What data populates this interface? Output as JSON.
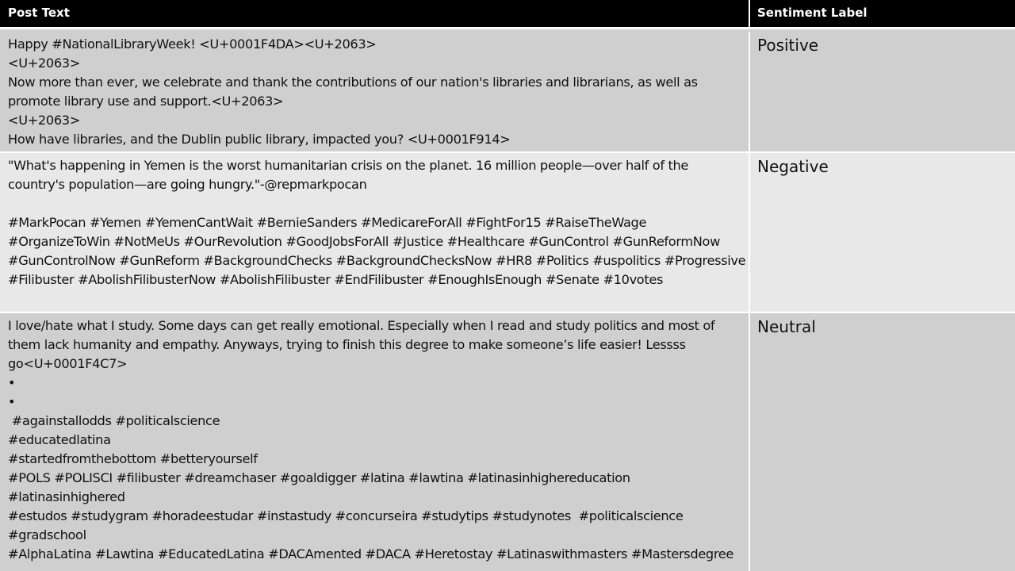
{
  "header": {
    "post_text": "Post Text",
    "sentiment_label": "Sentiment Label"
  },
  "rows": [
    {
      "post": "Happy #NationalLibraryWeek! <U+0001F4DA><U+2063>\n<U+2063>\nNow more than ever, we celebrate and thank the contributions of our nation's libraries and librarians, as well as promote library use and support.<U+2063>\n<U+2063>\nHow have libraries, and the Dublin public library, impacted you? <U+0001F914>",
      "label": "Positive"
    },
    {
      "post": "\"What's happening in Yemen is the worst humanitarian crisis on the planet. 16 million people—over half of the country's population—are going hungry.\"-@repmarkpocan\n\n#MarkPocan #Yemen #YemenCantWait #BernieSanders #MedicareForAll #FightFor15 #RaiseTheWage #OrganizeToWin #NotMeUs #OurRevolution #GoodJobsForAll #Justice #Healthcare #GunControl #GunReformNow #GunControlNow #GunReform #BackgroundChecks #BackgroundChecksNow #HR8 #Politics #uspolitics #Progressive #Filibuster #AbolishFilibusterNow #AbolishFilibuster #EndFilibuster #EnoughIsEnough #Senate #10votes",
      "label": "Negative"
    },
    {
      "post": "I love/hate what I study. Some days can get really emotional. Especially when I read and study politics and most of them lack humanity and empathy. Anyways, trying to finish this degree to make someone’s life easier! Lessss go<U+0001F4C7>\n•\n•\n #againstallodds #politicalscience\n#educatedlatina\n#startedfromthebottom #betteryourself\n#POLS #POLISCI #filibuster #dreamchaser #goaldigger #latina #lawtina #latinasinhighereducation\n#latinasinhighered\n#estudos #studygram #horadeestudar #instastudy #concurseira #studytips #studynotes  #politicalscience\n#gradschool\n#AlphaLatina #Lawtina #EducatedLatina #DACAmented #DACA #Heretostay #Latinaswithmasters #Mastersdegree",
      "label": "Neutral"
    }
  ]
}
